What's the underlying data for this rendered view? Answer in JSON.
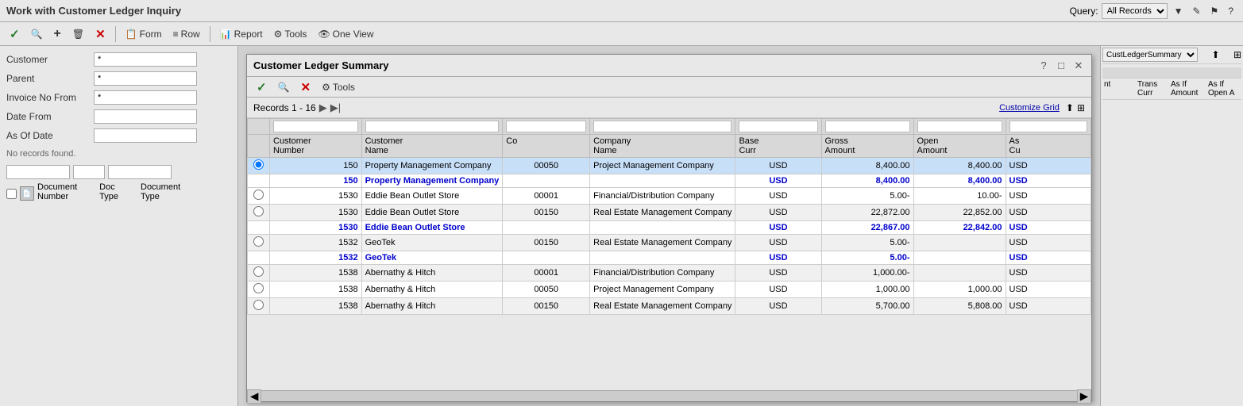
{
  "topBar": {
    "title": "Work with Customer Ledger Inquiry",
    "queryLabel": "Query:",
    "queryValue": "All Records"
  },
  "toolbar": {
    "buttons": [
      {
        "name": "check",
        "icon": "✓",
        "label": ""
      },
      {
        "name": "search",
        "icon": "🔍",
        "label": ""
      },
      {
        "name": "add",
        "icon": "+",
        "label": ""
      },
      {
        "name": "delete",
        "icon": "🗑",
        "label": ""
      },
      {
        "name": "cancel",
        "icon": "✕",
        "label": ""
      },
      {
        "name": "form",
        "icon": "📋",
        "label": "Form"
      },
      {
        "name": "row",
        "icon": "≡",
        "label": "Row"
      },
      {
        "name": "report",
        "icon": "📊",
        "label": "Report"
      },
      {
        "name": "tools",
        "icon": "⚙",
        "label": "Tools"
      },
      {
        "name": "oneview",
        "icon": "👁",
        "label": "One View"
      }
    ]
  },
  "leftPanel": {
    "fields": [
      {
        "label": "Customer",
        "value": "*"
      },
      {
        "label": "Parent",
        "value": "*"
      },
      {
        "label": "Invoice No From",
        "value": "*"
      },
      {
        "label": "Date From",
        "value": ""
      },
      {
        "label": "As Of Date",
        "value": ""
      }
    ],
    "noRecords": "No records found.",
    "docHeaders": [
      "Document",
      "Doc",
      "Document"
    ],
    "docSubHeaders": [
      "Number",
      "Type",
      "Type"
    ]
  },
  "modal": {
    "title": "Customer Ledger Summary",
    "recordsInfo": "Records 1 - 16",
    "customizeGrid": "Customize Grid",
    "columns": [
      {
        "key": "radio",
        "label": ""
      },
      {
        "key": "custNum",
        "label": "Customer Number"
      },
      {
        "key": "custName",
        "label": "Customer Name"
      },
      {
        "key": "co",
        "label": "Co"
      },
      {
        "key": "companyName",
        "label": "Company Name"
      },
      {
        "key": "baseCurr",
        "label": "Base Curr"
      },
      {
        "key": "grossAmount",
        "label": "Gross Amount"
      },
      {
        "key": "openAmount",
        "label": "Open Amount"
      },
      {
        "key": "asCu",
        "label": "As Cu"
      }
    ],
    "rows": [
      {
        "type": "data",
        "radio": true,
        "custNum": "150",
        "custName": "Property Management Company",
        "co": "00050",
        "companyName": "Project Management Company",
        "baseCurr": "USD",
        "grossAmount": "8,400.00",
        "openAmount": "8,400.00",
        "asCu": "USD"
      },
      {
        "type": "summary",
        "radio": false,
        "custNum": "150",
        "custName": "Property Management Company",
        "co": "",
        "companyName": "",
        "baseCurr": "USD",
        "grossAmount": "8,400.00",
        "openAmount": "8,400.00",
        "asCu": "USD"
      },
      {
        "type": "data",
        "radio": false,
        "custNum": "1530",
        "custName": "Eddie Bean Outlet Store",
        "co": "00001",
        "companyName": "Financial/Distribution Company",
        "baseCurr": "USD",
        "grossAmount": "5.00-",
        "openAmount": "10.00-",
        "asCu": "USD"
      },
      {
        "type": "data",
        "radio": false,
        "custNum": "1530",
        "custName": "Eddie Bean Outlet Store",
        "co": "00150",
        "companyName": "Real Estate Management Company",
        "baseCurr": "USD",
        "grossAmount": "22,872.00",
        "openAmount": "22,852.00",
        "asCu": "USD"
      },
      {
        "type": "summary",
        "radio": false,
        "custNum": "1530",
        "custName": "Eddie Bean Outlet Store",
        "co": "",
        "companyName": "",
        "baseCurr": "USD",
        "grossAmount": "22,867.00",
        "openAmount": "22,842.00",
        "asCu": "USD"
      },
      {
        "type": "data",
        "radio": false,
        "custNum": "1532",
        "custName": "GeoTek",
        "co": "00150",
        "companyName": "Real Estate Management Company",
        "baseCurr": "USD",
        "grossAmount": "5.00-",
        "openAmount": "",
        "asCu": "USD"
      },
      {
        "type": "summary",
        "radio": false,
        "custNum": "1532",
        "custName": "GeoTek",
        "co": "",
        "companyName": "",
        "baseCurr": "USD",
        "grossAmount": "5.00-",
        "openAmount": "",
        "asCu": "USD"
      },
      {
        "type": "data",
        "radio": false,
        "custNum": "1538",
        "custName": "Abernathy & Hitch",
        "co": "00001",
        "companyName": "Financial/Distribution Company",
        "baseCurr": "USD",
        "grossAmount": "1,000.00-",
        "openAmount": "",
        "asCu": "USD"
      },
      {
        "type": "data",
        "radio": false,
        "custNum": "1538",
        "custName": "Abernathy & Hitch",
        "co": "00050",
        "companyName": "Project Management Company",
        "baseCurr": "USD",
        "grossAmount": "1,000.00",
        "openAmount": "1,000.00",
        "asCu": "USD"
      },
      {
        "type": "data",
        "radio": false,
        "custNum": "1538",
        "custName": "Abernathy & Hitch",
        "co": "00150",
        "companyName": "Real Estate Management Company",
        "baseCurr": "USD",
        "grossAmount": "5,700.00",
        "openAmount": "5,808.00",
        "asCu": "USD"
      }
    ]
  },
  "rightPanel": {
    "selectValue": "CustLedgerSummary",
    "columns": [
      "Trans",
      "As If",
      "As If"
    ],
    "subColumns": [
      "Curr",
      "Amount",
      "Open A"
    ]
  }
}
